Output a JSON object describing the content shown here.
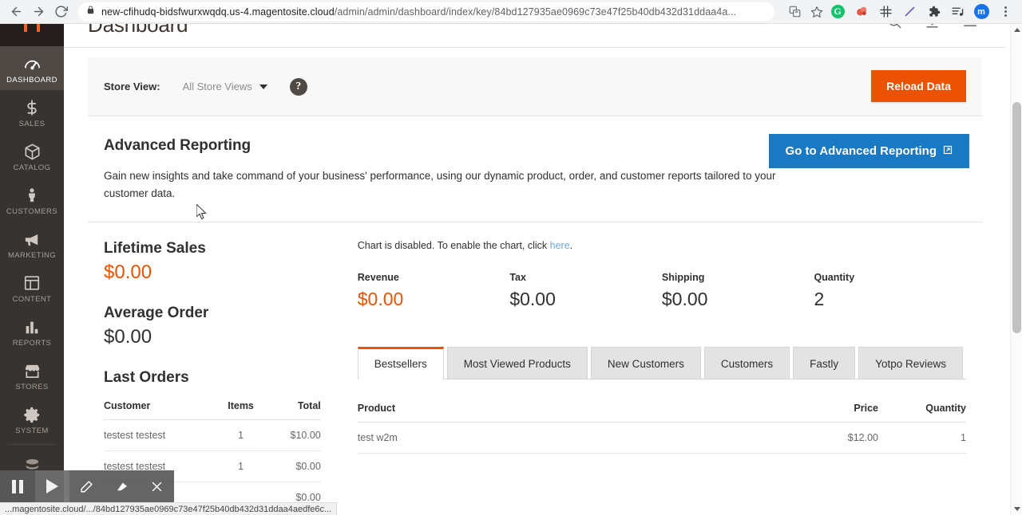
{
  "browser": {
    "back_label": "Back",
    "forward_label": "Forward",
    "reload_label": "Reload",
    "url_host": "new-cfihudq-bidsfwurxwqdq.us-4.magentosite.cloud",
    "url_path": "/admin/admin/dashboard/index/key/84bd127935ae0969c73e47f25b40db432d31ddaa4a...",
    "toolbar_icons": [
      "translate-icon",
      "bookmark-star-icon",
      "grammarly-icon",
      "adblock-icon",
      "grid-icon",
      "marker-icon",
      "extensions-puzzle-icon",
      "reading-list-icon"
    ],
    "profile_initial": "m",
    "menu_label": "Customize and control"
  },
  "statusbar": {
    "text": "...magentosite.cloud/.../84bd127935ae0969c73e47f25b40db432d31ddaa4aedfe6c..."
  },
  "recorder": {
    "buttons": [
      "pause-icon",
      "play-icon",
      "pen-icon",
      "highlighter-icon",
      "close-icon"
    ]
  },
  "adminnav": {
    "logo": "magento-logo",
    "items": [
      {
        "label": "DASHBOARD",
        "icon": "gauge-icon",
        "active": true
      },
      {
        "label": "SALES",
        "icon": "dollar-icon",
        "active": false
      },
      {
        "label": "CATALOG",
        "icon": "box-icon",
        "active": false
      },
      {
        "label": "CUSTOMERS",
        "icon": "person-icon",
        "active": false
      },
      {
        "label": "MARKETING",
        "icon": "megaphone-icon",
        "active": false
      },
      {
        "label": "CONTENT",
        "icon": "layout-icon",
        "active": false
      },
      {
        "label": "REPORTS",
        "icon": "bar-chart-icon",
        "active": false
      },
      {
        "label": "STORES",
        "icon": "store-icon",
        "active": false
      },
      {
        "label": "SYSTEM",
        "icon": "gear-icon",
        "active": false
      }
    ]
  },
  "header": {
    "title": "Dashboard",
    "icons": [
      "search-icon",
      "download-icon",
      "menu-icon"
    ]
  },
  "storebar": {
    "label": "Store View:",
    "selected": "All Store Views",
    "help": "?",
    "reload_label": "Reload Data"
  },
  "advanced_reporting": {
    "title": "Advanced Reporting",
    "description": "Gain new insights and take command of your business' performance, using our dynamic product, order, and customer reports tailored to your customer data.",
    "button_label": "Go to Advanced Reporting",
    "button_icon": "external-link-icon"
  },
  "lifetime_sales": {
    "label": "Lifetime Sales",
    "value": "$0.00"
  },
  "average_order": {
    "label": "Average Order",
    "value": "$0.00"
  },
  "last_orders": {
    "title": "Last Orders",
    "columns": [
      "Customer",
      "Items",
      "Total"
    ],
    "rows": [
      {
        "customer": "testest testest",
        "items": "1",
        "total": "$10.00"
      },
      {
        "customer": "testest testest",
        "items": "1",
        "total": "$0.00"
      },
      {
        "customer": "",
        "items": "",
        "total": "$0.00"
      }
    ]
  },
  "chart": {
    "message_prefix": "Chart is disabled. To enable the chart, click ",
    "link_label": "here",
    "message_suffix": "."
  },
  "stats": [
    {
      "label": "Revenue",
      "value": "$0.00",
      "highlight": true
    },
    {
      "label": "Tax",
      "value": "$0.00",
      "highlight": false
    },
    {
      "label": "Shipping",
      "value": "$0.00",
      "highlight": false
    },
    {
      "label": "Quantity",
      "value": "2",
      "highlight": false
    }
  ],
  "tabs": [
    {
      "label": "Bestsellers",
      "active": true
    },
    {
      "label": "Most Viewed Products",
      "active": false
    },
    {
      "label": "New Customers",
      "active": false
    },
    {
      "label": "Customers",
      "active": false
    },
    {
      "label": "Fastly",
      "active": false
    },
    {
      "label": "Yotpo Reviews",
      "active": false
    }
  ],
  "bestsellers": {
    "columns": [
      "Product",
      "Price",
      "Quantity"
    ],
    "rows": [
      {
        "product": "test w2m",
        "price": "$12.00",
        "quantity": "1"
      }
    ]
  },
  "colors": {
    "accent_orange": "#eb5202",
    "link_blue": "#1979c3",
    "nav_dark": "#373330"
  }
}
